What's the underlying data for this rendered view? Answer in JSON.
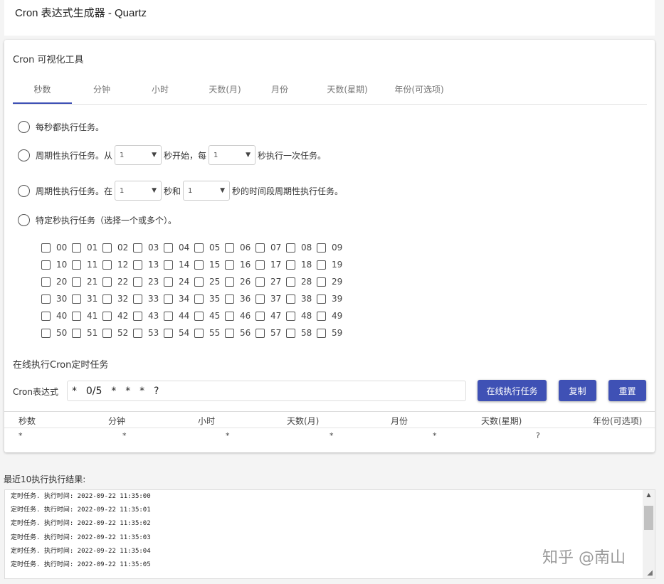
{
  "header": {
    "title": "Cron 表达式生成器 - Quartz"
  },
  "card": {
    "title": "Cron 可视化工具"
  },
  "tabs": [
    {
      "label": "秒数",
      "active": true
    },
    {
      "label": "分钟"
    },
    {
      "label": "小时"
    },
    {
      "label": "天数(月)"
    },
    {
      "label": "月份"
    },
    {
      "label": "天数(星期)"
    },
    {
      "label": "年份(可选项)"
    }
  ],
  "options": {
    "every": "每秒都执行任务。",
    "cycle": {
      "prefix": "周期性执行任务。从",
      "start_value": "1",
      "middle": "秒开始，每",
      "step_value": "1",
      "suffix": "秒执行一次任务。"
    },
    "range": {
      "prefix": "周期性执行任务。在",
      "from_value": "1",
      "middle": "秒和",
      "to_value": "1",
      "suffix": "秒的时间段周期性执行任务。"
    },
    "specific": "特定秒执行任务（选择一个或多个）。"
  },
  "seconds": [
    [
      "00",
      "01",
      "02",
      "03",
      "04",
      "05",
      "06",
      "07",
      "08",
      "09"
    ],
    [
      "10",
      "11",
      "12",
      "13",
      "14",
      "15",
      "16",
      "17",
      "18",
      "19"
    ],
    [
      "20",
      "21",
      "22",
      "23",
      "24",
      "25",
      "26",
      "27",
      "28",
      "29"
    ],
    [
      "30",
      "31",
      "32",
      "33",
      "34",
      "35",
      "36",
      "37",
      "38",
      "39"
    ],
    [
      "40",
      "41",
      "42",
      "43",
      "44",
      "45",
      "46",
      "47",
      "48",
      "49"
    ],
    [
      "50",
      "51",
      "52",
      "53",
      "54",
      "55",
      "56",
      "57",
      "58",
      "59"
    ]
  ],
  "exec": {
    "title": "在线执行Cron定时任务",
    "expr_label": "Cron表达式",
    "expr_value": "*  0/5  *  *  *  ?",
    "run_label": "在线执行任务",
    "copy_label": "复制",
    "reset_label": "重置"
  },
  "table": {
    "headers": [
      "秒数",
      "分钟",
      "小时",
      "天数(月)",
      "月份",
      "天数(星期)",
      "年份(可选项)"
    ],
    "values": [
      "*",
      "*",
      "*",
      "*",
      "*",
      "?",
      ""
    ]
  },
  "results": {
    "label": "最近10执行执行结果:",
    "lines": [
      "定时任务. 执行时间: 2022-09-22 11:35:00",
      "定时任务. 执行时间: 2022-09-22 11:35:01",
      "定时任务. 执行时间: 2022-09-22 11:35:02",
      "定时任务. 执行时间: 2022-09-22 11:35:03",
      "定时任务. 执行时间: 2022-09-22 11:35:04",
      "定时任务. 执行时间: 2022-09-22 11:35:05"
    ]
  },
  "watermark": "知乎 @南山",
  "colors": {
    "primary": "#3f51b5"
  },
  "icons": {
    "select_caret": "▼",
    "scroll_up": "▲",
    "resize": "◢"
  }
}
